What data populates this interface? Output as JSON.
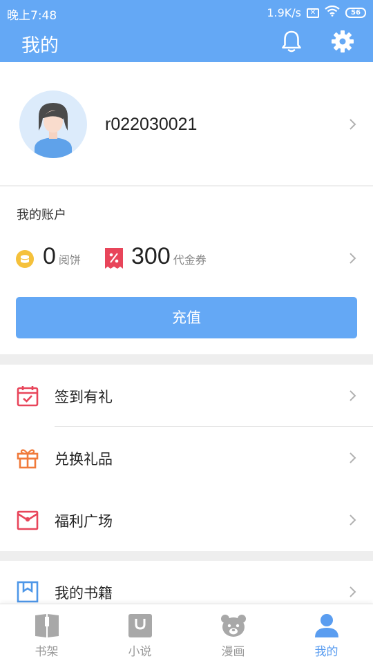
{
  "status_bar": {
    "time": "晚上7:48",
    "speed": "1.9K/s",
    "battery": "56"
  },
  "header": {
    "title": "我的"
  },
  "profile": {
    "username": "r022030021"
  },
  "account": {
    "title": "我的账户",
    "coins": {
      "value": "0",
      "unit": "阅饼"
    },
    "coupons": {
      "value": "300",
      "unit": "代金券"
    },
    "recharge_label": "充值"
  },
  "menu": [
    {
      "label": "签到有礼",
      "icon": "calendar-check-icon",
      "color": "#e8455a"
    },
    {
      "label": "兑换礼品",
      "icon": "gift-icon",
      "color": "#f07a3a"
    },
    {
      "label": "福利广场",
      "icon": "envelope-icon",
      "color": "#e8455a"
    },
    {
      "label": "我的书籍",
      "icon": "bookmark-book-icon",
      "color": "#4e97e8"
    }
  ],
  "tabs": [
    {
      "label": "书架",
      "icon": "bookshelf-icon"
    },
    {
      "label": "小说",
      "icon": "novel-bag-icon"
    },
    {
      "label": "漫画",
      "icon": "bear-face-icon"
    },
    {
      "label": "我的",
      "icon": "person-icon",
      "active": true
    }
  ],
  "colors": {
    "accent": "#64a8f5",
    "active_tab": "#5a9df0",
    "coin": "#f5c13b",
    "coupon": "#e8455a"
  }
}
